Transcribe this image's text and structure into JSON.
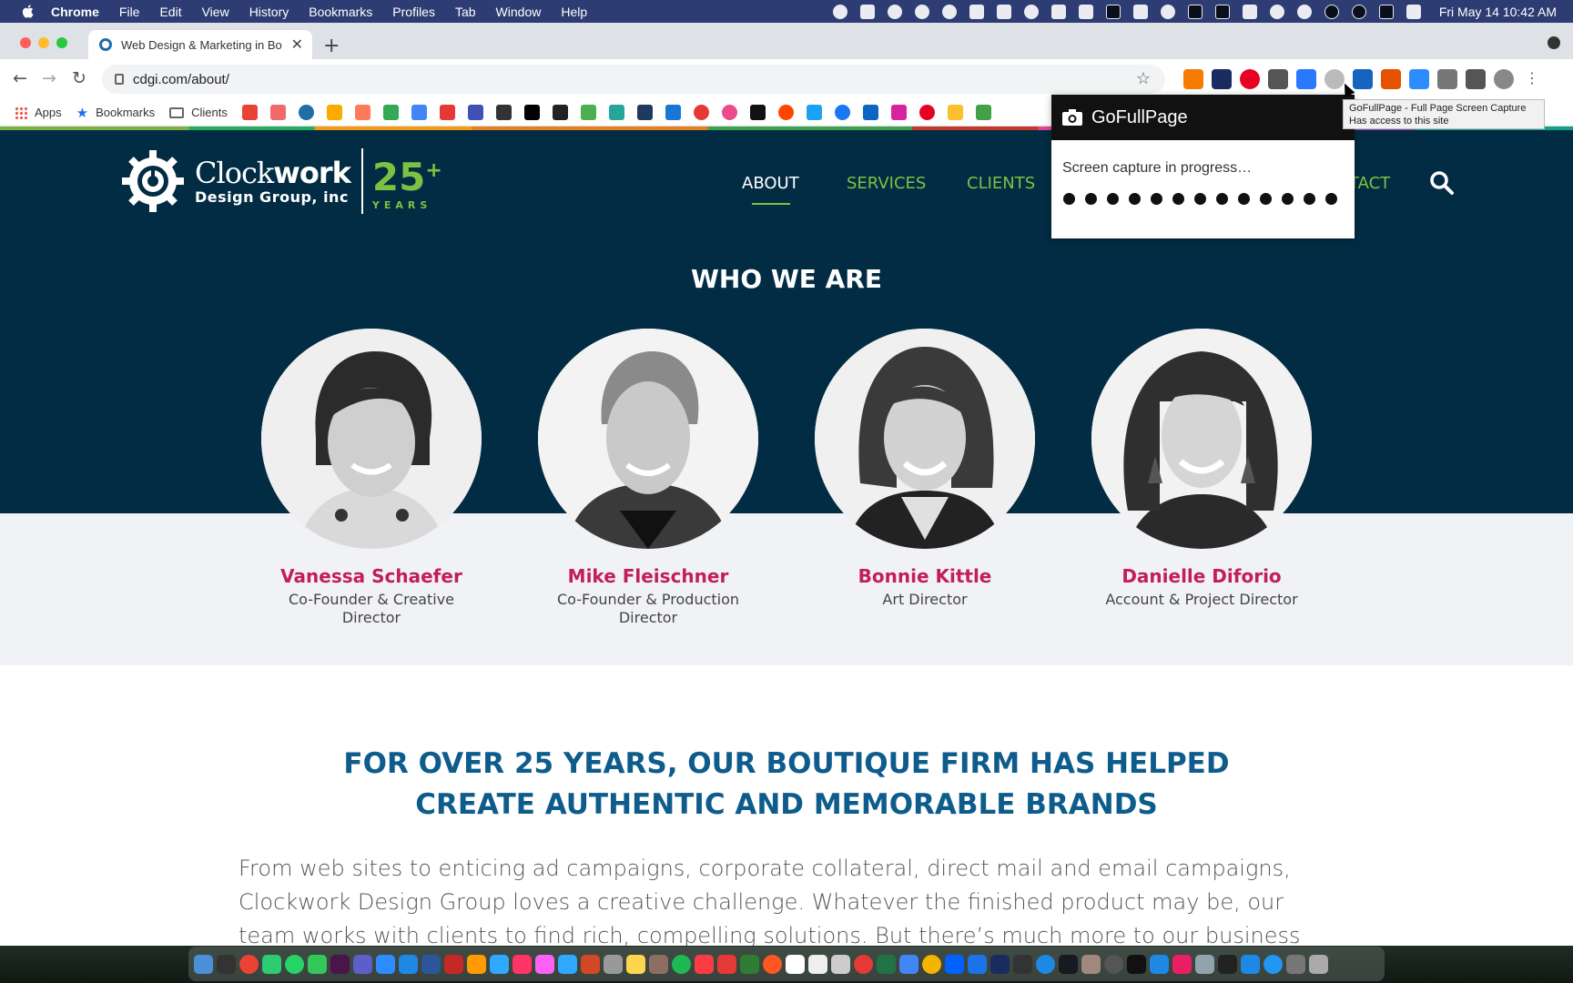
{
  "menubar": {
    "app_name": "Chrome",
    "items": [
      "File",
      "Edit",
      "View",
      "History",
      "Bookmarks",
      "Profiles",
      "Tab",
      "Window",
      "Help"
    ],
    "clock": "Fri May 14  10:42 AM"
  },
  "browser": {
    "tab_title": "Web Design & Marketing in Bo",
    "url": "cdgi.com/about/",
    "bookmarks": {
      "apps": "Apps",
      "bookmarks": "Bookmarks",
      "clients": "Clients"
    }
  },
  "extension_popup": {
    "title": "GoFullPage",
    "message": "Screen capture in progress…",
    "tooltip_line1": "GoFullPage - Full Page Screen Capture",
    "tooltip_line2": "Has access to this site"
  },
  "site": {
    "logo": {
      "line1_light": "Clock",
      "line1_bold": "work",
      "line2": "Design Group, inc",
      "years_number": "25",
      "years_plus": "+",
      "years_label": "YEARS"
    },
    "nav": {
      "about": "ABOUT",
      "services": "SERVICES",
      "clients": "CLIENTS",
      "contact_partial": "TACT"
    },
    "section_title": "WHO WE ARE",
    "team": [
      {
        "name": "Vanessa Schaefer",
        "role": "Co-Founder & Creative Director"
      },
      {
        "name": "Mike Fleischner",
        "role": "Co-Founder & Production Director"
      },
      {
        "name": "Bonnie Kittle",
        "role": "Art Director"
      },
      {
        "name": "Danielle Diforio",
        "role": "Account & Project Director"
      }
    ],
    "headline_line1": "FOR OVER 25 YEARS, OUR BOUTIQUE FIRM HAS HELPED",
    "headline_line2": "CREATE AUTHENTIC AND MEMORABLE BRANDS",
    "body": "From web sites to enticing ad campaigns, corporate collateral, direct mail and email campaigns, Clockwork Design Group loves a creative challenge. Whatever the finished product may be, our team works with clients to find rich, compelling solutions. But there’s much more to our business than creativity. With a name like"
  },
  "colors": {
    "hero_navy": "#022c43",
    "accent_green": "#7cc242",
    "name_magenta": "#c21d5c",
    "headline_blue": "#0d5c8c"
  }
}
